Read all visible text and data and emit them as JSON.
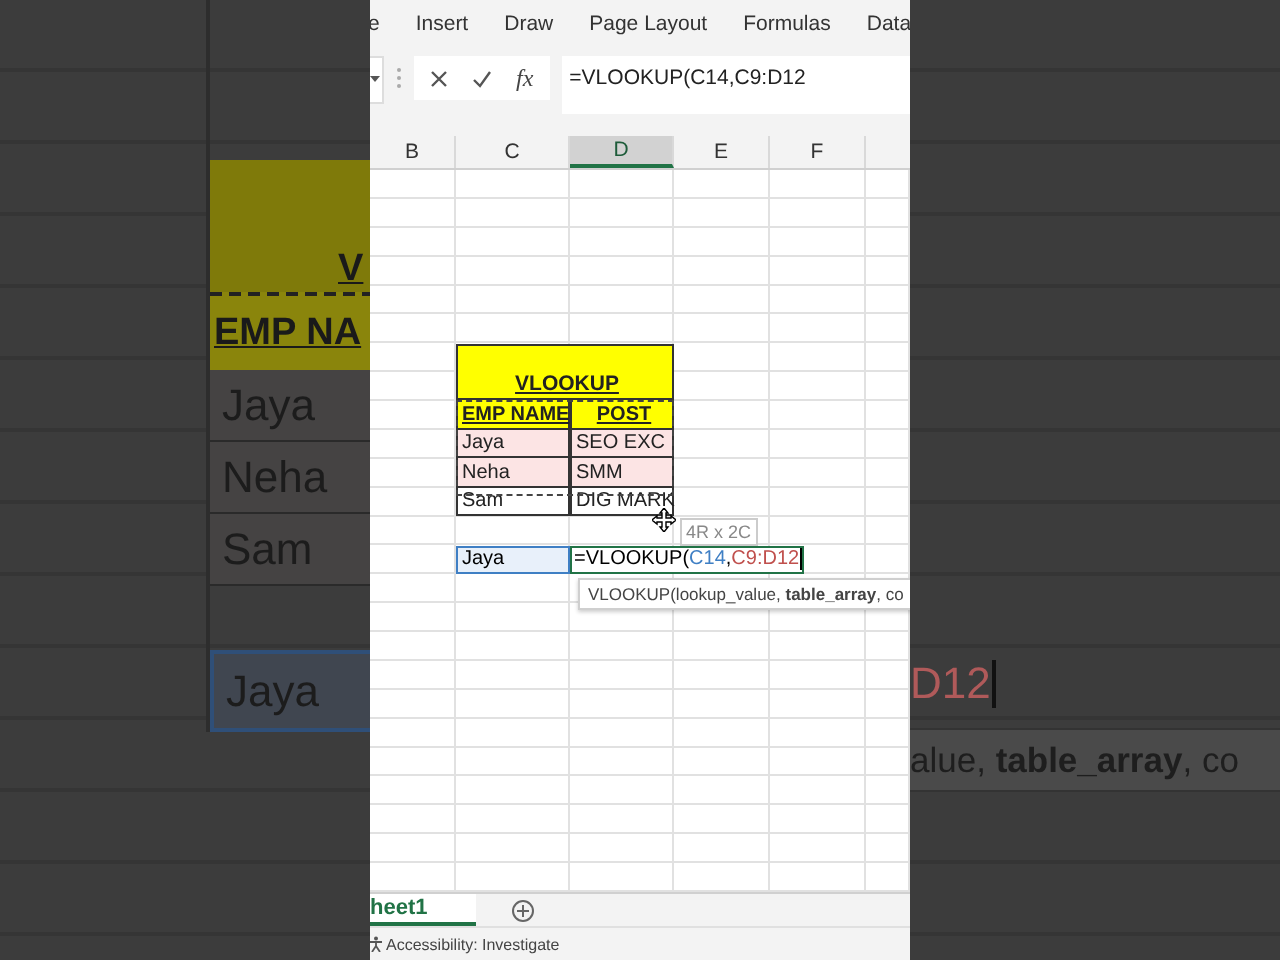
{
  "backdrop": {
    "left": {
      "title_fragment": "V",
      "header_fragment": "EMP NA",
      "names": [
        "Jaya",
        "Neha",
        "Sam"
      ],
      "lookup_value": "Jaya"
    },
    "right": {
      "formula_fragment": "D12",
      "tooltip_fragment": "alue, **table_array**, co"
    }
  },
  "ribbon_tabs": [
    {
      "label": "e"
    },
    {
      "label": "Insert"
    },
    {
      "label": "Draw"
    },
    {
      "label": "Page Layout"
    },
    {
      "label": "Formulas"
    },
    {
      "label": "Data"
    }
  ],
  "formula_bar": {
    "function_label": "fx",
    "formula": "=VLOOKUP(C14,C9:D12"
  },
  "column_headers": [
    {
      "label": "B",
      "selected": false
    },
    {
      "label": "C",
      "selected": false
    },
    {
      "label": "D",
      "selected": true
    },
    {
      "label": "E",
      "selected": false
    },
    {
      "label": "F",
      "selected": false
    }
  ],
  "table": {
    "title": "VLOOKUP",
    "columns": [
      "EMP NAME",
      "POST"
    ],
    "rows": [
      {
        "cells": [
          "Jaya",
          "SEO EXC"
        ],
        "highlighted": true
      },
      {
        "cells": [
          "Neha",
          "SMM"
        ],
        "highlighted": true
      },
      {
        "cells": [
          "Sam",
          "DIG MARK"
        ],
        "highlighted": false
      }
    ]
  },
  "lookup": {
    "value": "Jaya",
    "formula_parts": [
      {
        "text": "=VLOOKUP(",
        "kind": "plain"
      },
      {
        "text": "C14",
        "kind": "ref",
        "color": "#3f7fc4"
      },
      {
        "text": ",",
        "kind": "plain"
      },
      {
        "text": "C9:D12",
        "kind": "ref",
        "color": "#c0504d"
      }
    ]
  },
  "range_tooltip": "4R x 2C",
  "function_tooltip": "VLOOKUP(lookup_value, **table_array**, co",
  "sheet_tabs": [
    {
      "label": "heet1",
      "selected": true
    }
  ],
  "status_bar": {
    "text": "Accessibility: Investigate"
  }
}
